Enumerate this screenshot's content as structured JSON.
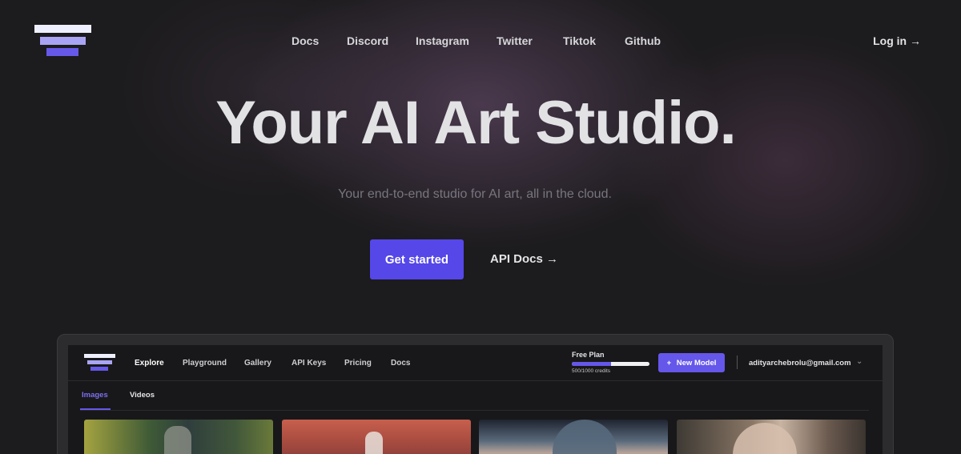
{
  "header": {
    "nav": [
      "Docs",
      "Discord",
      "Instagram",
      "Twitter",
      "Tiktok",
      "Github"
    ],
    "login": "Log in →"
  },
  "hero": {
    "title": "Your AI Art Studio.",
    "subtitle": "Your end-to-end studio for AI art, all in the cloud.",
    "cta_primary": "Get started",
    "cta_secondary": "API Docs →"
  },
  "preview": {
    "nav": [
      "Explore",
      "Playground",
      "Gallery",
      "API Keys",
      "Pricing",
      "Docs"
    ],
    "active_nav": "Explore",
    "plan": {
      "title": "Free Plan",
      "credits_label": "500/1000 credits",
      "used_fraction": 0.5
    },
    "new_model_label": "New Model",
    "user_email": "adityarchebrolu@gmail.com",
    "tabs": [
      "Images",
      "Videos"
    ],
    "active_tab": "Images"
  },
  "icons": {
    "logo": "stacked-bars-logo",
    "plus": "plus-icon",
    "chevron": "chevron-down-icon"
  },
  "colors": {
    "accent": "#5547e8",
    "background": "#1c1b1d"
  }
}
